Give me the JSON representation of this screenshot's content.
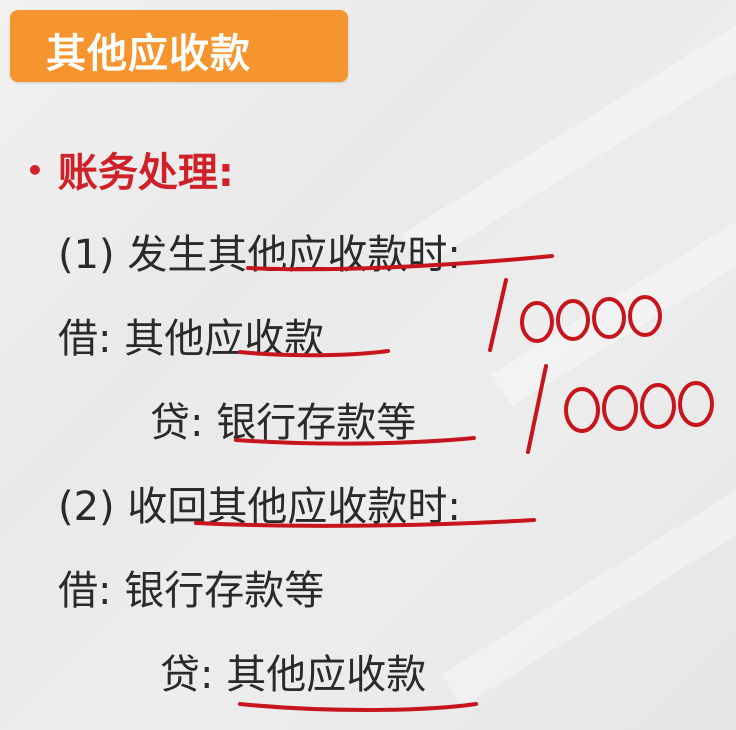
{
  "title": "其他应收款",
  "heading": {
    "bullet": "•",
    "text": "账务处理:"
  },
  "steps": [
    {
      "label": "(1)",
      "prefix": "发生",
      "emphasis": "其他应收款时",
      "suffix": ":",
      "debit": {
        "label": "借:",
        "pre": "其他",
        "account": "应收款"
      },
      "credit": {
        "label": "贷:",
        "account": "银行存款等"
      }
    },
    {
      "label": "(2)",
      "prefix": "收",
      "emphasis": "回其他应收款时",
      "suffix": ":",
      "debit": {
        "label": "借:",
        "account": "银行存款等"
      },
      "credit": {
        "label": "贷:",
        "account": "其他应收款"
      }
    }
  ],
  "annotations": {
    "debit_amount": "10000",
    "credit_amount": "10000"
  },
  "colors": {
    "accent": "#f6952e",
    "heading": "#cf2129",
    "ink": "#c8141c",
    "text": "#2a2a2a"
  }
}
